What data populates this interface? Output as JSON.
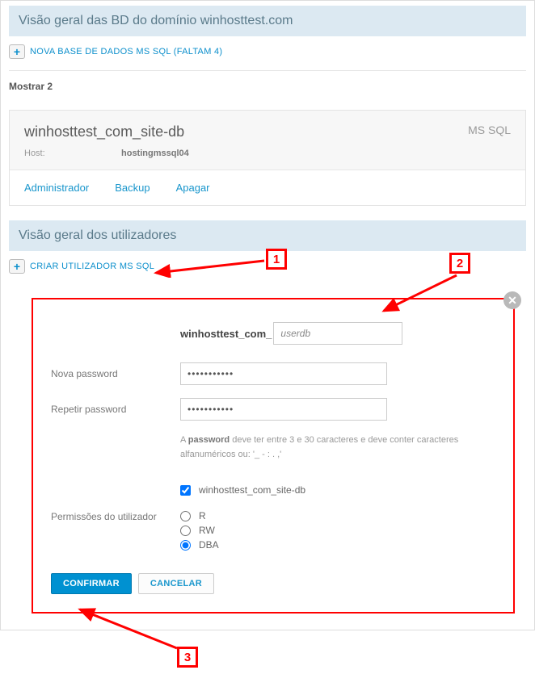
{
  "headers": {
    "db_overview": "Visão geral das BD do domínio winhosttest.com",
    "users_overview": "Visão geral dos utilizadores"
  },
  "add_links": {
    "new_db": "NOVA BASE DE DADOS MS SQL (FALTAM 4)",
    "new_user": "CRIAR UTILIZADOR MS SQL"
  },
  "summary": {
    "show_text": "Mostrar 2"
  },
  "db": {
    "title": "winhosttest_com_site-db",
    "type": "MS SQL",
    "host_label": "Host:",
    "host_value": "hostingmssql04",
    "actions": {
      "admin": "Administrador",
      "backup": "Backup",
      "delete": "Apagar"
    }
  },
  "form": {
    "user_prefix": "winhosttest_com_",
    "user_value": "userdb",
    "newpass_label": "Nova password",
    "newpass_value": "•••••••••••",
    "reppass_label": "Repetir password",
    "reppass_value": "•••••••••••",
    "helper_pre": "A ",
    "helper_bold": "password",
    "helper_post": " deve ter entre 3 e 30 caracteres e deve conter caracteres alfanuméricos ou: '_ - : . ,'",
    "db_checkbox_label": "winhosttest_com_site-db",
    "perm_label": "Permissões do utilizador",
    "perm_r": "R",
    "perm_rw": "RW",
    "perm_dba": "DBA",
    "confirm": "CONFIRMAR",
    "cancel": "CANCELAR"
  },
  "callouts": {
    "n1": "1",
    "n2": "2",
    "n3": "3"
  }
}
